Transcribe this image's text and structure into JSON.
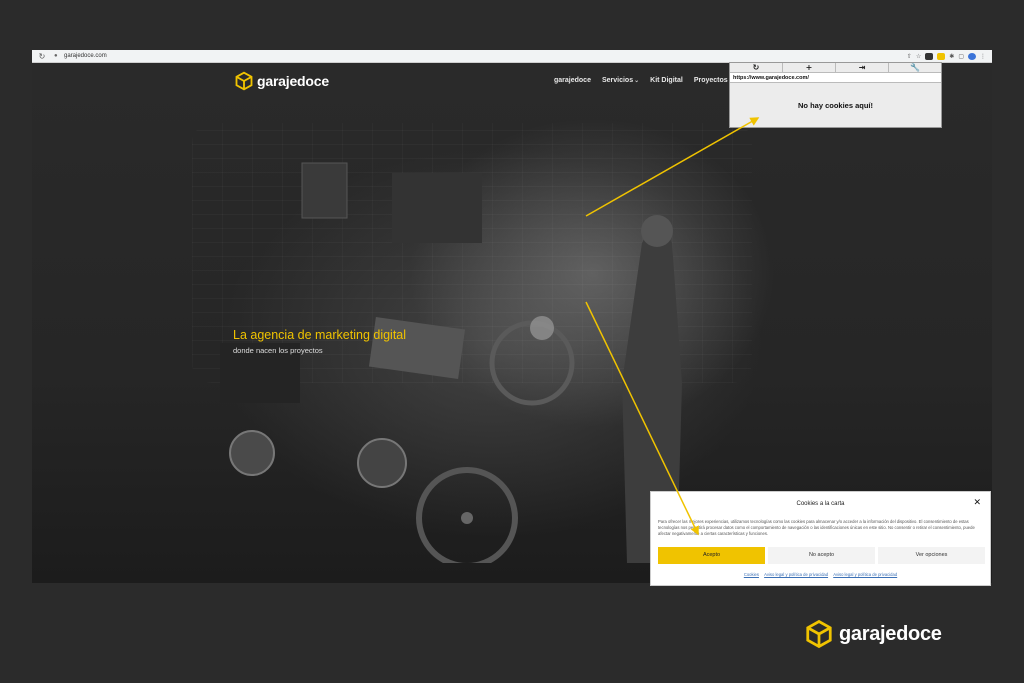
{
  "browser": {
    "url": "garajedoce.com",
    "reload_icon": "↻",
    "lock_icon": "🔒"
  },
  "site": {
    "logo_text": "garajedoce",
    "nav": [
      {
        "label": "garajedoce"
      },
      {
        "label": "Servicios",
        "has_dropdown": true
      },
      {
        "label": "Kit Digital"
      },
      {
        "label": "Proyectos"
      }
    ],
    "headline": "La agencia de marketing digital",
    "subheadline": "donde nacen los proyectos"
  },
  "extension_popup": {
    "tools": [
      {
        "icon": "reload-icon",
        "glyph": "↻"
      },
      {
        "icon": "plus-icon",
        "glyph": "+"
      },
      {
        "icon": "login-icon",
        "glyph": "⇥"
      },
      {
        "icon": "wrench-icon",
        "glyph": "🔧"
      }
    ],
    "url": "https://www.garajedoce.com/",
    "message": "No hay cookies aquí!"
  },
  "cookie_dialog": {
    "title": "Cookies a la carta",
    "close": "✕",
    "text": "Para ofrecer las mejores experiencias, utilizamos tecnologías como las cookies para almacenar y/o acceder a la información del dispositivo. El consentimiento de estas tecnologías nos permitirá procesar datos como el comportamiento de navegación o las identificaciones únicas en este sitio. No consentir o retirar el consentimiento, puede afectar negativamente a ciertas características y funciones.",
    "accept_label": "Acepto",
    "reject_label": "No acepto",
    "options_label": "Ver opciones",
    "links": [
      "Cookies",
      "Aviso legal y política de privacidad",
      "Aviso legal y política de privacidad"
    ]
  },
  "brand_footer": {
    "text": "garajedoce"
  },
  "colors": {
    "accent": "#f0c300",
    "background": "#2b2b2b"
  }
}
